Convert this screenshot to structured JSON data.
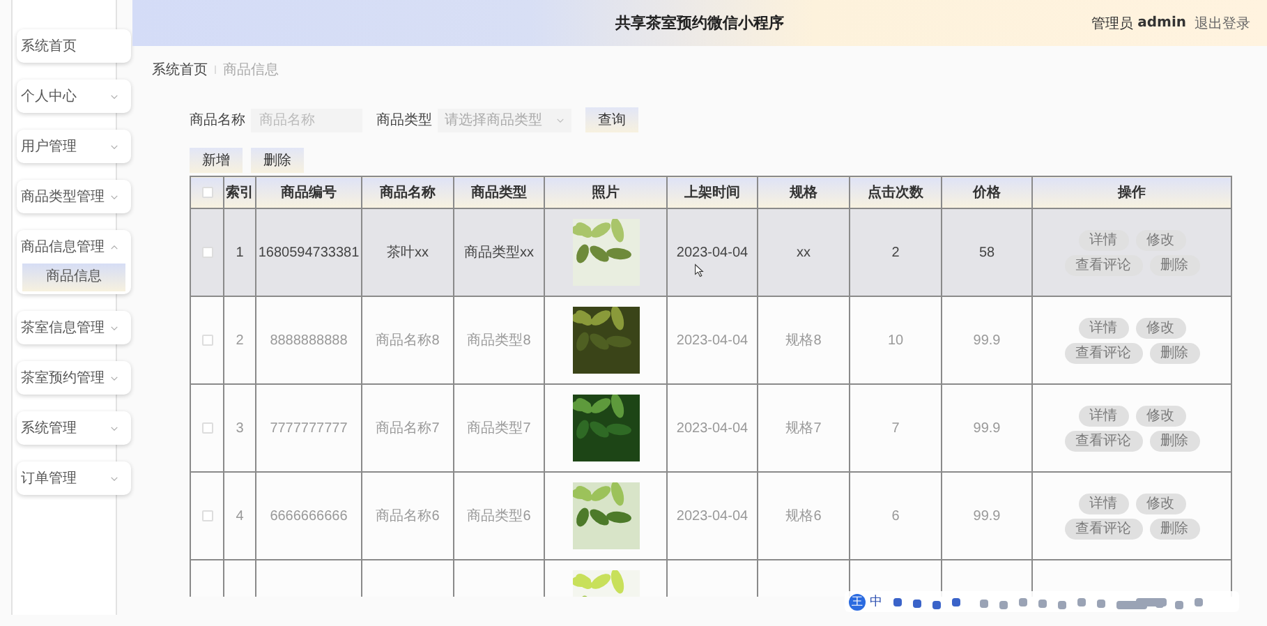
{
  "header": {
    "title": "共享茶室预约微信小程序",
    "user_role": "管理员",
    "user_name": "admin",
    "logout": "退出登录"
  },
  "sidebar": {
    "items": [
      {
        "label": "系统首页",
        "kind": "link"
      },
      {
        "label": "个人中心",
        "kind": "group",
        "expanded": false
      },
      {
        "label": "用户管理",
        "kind": "group",
        "expanded": false
      },
      {
        "label": "商品类型管理",
        "kind": "group",
        "expanded": false
      },
      {
        "label": "商品信息管理",
        "kind": "group",
        "expanded": true,
        "children": [
          {
            "label": "商品信息",
            "selected": true
          }
        ]
      },
      {
        "label": "茶室信息管理",
        "kind": "group",
        "expanded": false
      },
      {
        "label": "茶室预约管理",
        "kind": "group",
        "expanded": false
      },
      {
        "label": "系统管理",
        "kind": "group",
        "expanded": false
      },
      {
        "label": "订单管理",
        "kind": "group",
        "expanded": false
      }
    ]
  },
  "breadcrumb": [
    "系统首页",
    "商品信息"
  ],
  "search": {
    "fields": [
      {
        "label": "商品名称",
        "kind": "text",
        "placeholder": "商品名称"
      },
      {
        "label": "商品类型",
        "kind": "select",
        "placeholder": "请选择商品类型"
      }
    ],
    "button": "查询"
  },
  "toolbar": [
    "新增",
    "删除"
  ],
  "table": {
    "select_all": {
      "checked": false
    },
    "columns": [
      "索引",
      "商品编号",
      "商品名称",
      "商品类型",
      "照片",
      "上架时间",
      "规格",
      "点击次数",
      "价格",
      "操作"
    ],
    "rows": [
      {
        "kind": "full",
        "selected": true,
        "checked": false,
        "cells": [
          "1",
          "1680594733381",
          "茶叶xx",
          "商品类型xx",
          "2023-04-04",
          "xx",
          "2",
          "58"
        ],
        "actions": [
          "详情",
          "修改",
          "查看评论",
          "删除"
        ]
      },
      {
        "kind": "full",
        "selected": false,
        "checked": false,
        "cells": [
          "2",
          "8888888888",
          "商品名称8",
          "商品类型8",
          "2023-04-04",
          "规格8",
          "10",
          "99.9"
        ],
        "actions": [
          "详情",
          "修改",
          "查看评论",
          "删除"
        ]
      },
      {
        "kind": "full",
        "selected": false,
        "checked": false,
        "cells": [
          "3",
          "7777777777",
          "商品名称7",
          "商品类型7",
          "2023-04-04",
          "规格7",
          "7",
          "99.9"
        ],
        "actions": [
          "详情",
          "修改",
          "查看评论",
          "删除"
        ]
      },
      {
        "kind": "full",
        "selected": false,
        "checked": false,
        "cells": [
          "4",
          "6666666666",
          "商品名称6",
          "商品类型6",
          "2023-04-04",
          "规格6",
          "6",
          "99.9"
        ],
        "actions": [
          "详情",
          "修改",
          "查看评论",
          "删除"
        ]
      },
      {
        "kind": "cut",
        "selected": false
      }
    ]
  },
  "ime_toolbar": {
    "badge": "王",
    "mode": "中"
  }
}
